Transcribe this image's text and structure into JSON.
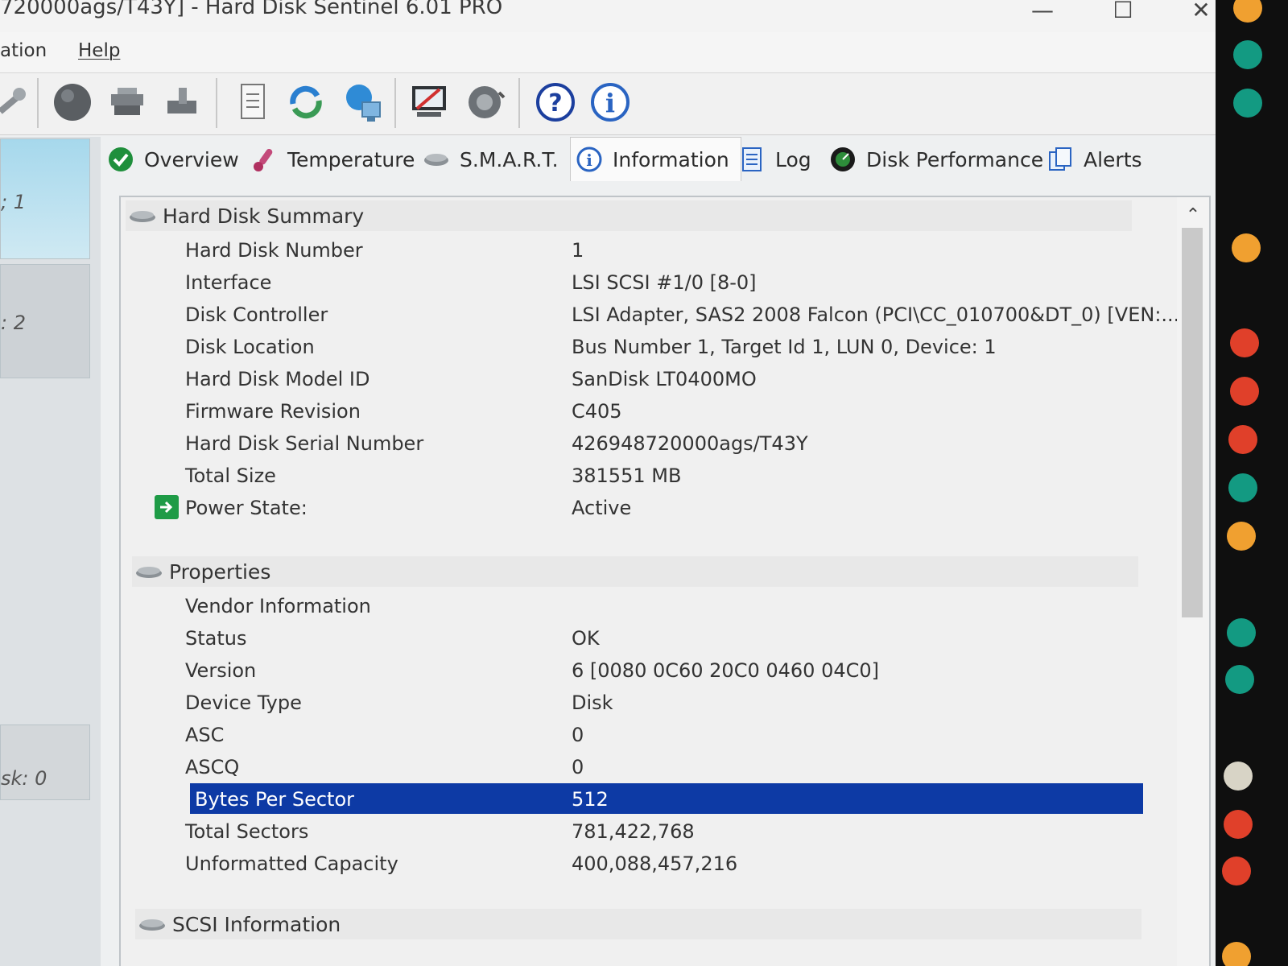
{
  "window": {
    "title": "720000ags/T43Y]  -  Hard Disk Sentinel 6.01 PRO",
    "minimize_label": "—",
    "maximize_label": "☐",
    "close_label": "✕"
  },
  "menu": {
    "items": [
      "ation",
      "Help"
    ]
  },
  "left_pane": {
    "disks": [
      "; 1",
      ": 2",
      "sk: 0"
    ]
  },
  "tabs": [
    {
      "label": "Overview",
      "icon": "check-circle-icon"
    },
    {
      "label": "Temperature",
      "icon": "thermometer-icon"
    },
    {
      "label": "S.M.A.R.T.",
      "icon": "disk-icon"
    },
    {
      "label": "Information",
      "icon": "info-icon"
    },
    {
      "label": "Log",
      "icon": "document-icon"
    },
    {
      "label": "Disk Performance",
      "icon": "performance-icon"
    },
    {
      "label": "Alerts",
      "icon": "alerts-icon"
    }
  ],
  "active_tab": "Information",
  "summary": {
    "title": "Hard Disk Summary",
    "rows": [
      {
        "key": "Hard Disk Number",
        "value": "1"
      },
      {
        "key": "Interface",
        "value": "LSI  SCSI #1/0 [8-0]"
      },
      {
        "key": "Disk Controller",
        "value": "LSI Adapter, SAS2 2008 Falcon (PCI\\CC_010700&DT_0) [VEN:..."
      },
      {
        "key": "Disk Location",
        "value": "Bus Number 1, Target Id 1, LUN 0, Device: 1"
      },
      {
        "key": "Hard Disk Model ID",
        "value": "SanDisk LT0400MO"
      },
      {
        "key": "Firmware Revision",
        "value": "C405"
      },
      {
        "key": "Hard Disk Serial Number",
        "value": "426948720000ags/T43Y"
      },
      {
        "key": "Total Size",
        "value": "381551 MB"
      },
      {
        "key": "Power State:",
        "value": "Active"
      }
    ]
  },
  "properties": {
    "title": "Properties",
    "rows": [
      {
        "key": "Vendor Information",
        "value": ""
      },
      {
        "key": "Status",
        "value": "OK"
      },
      {
        "key": "Version",
        "value": "6 [0080 0C60 20C0 0460 04C0]"
      },
      {
        "key": "Device Type",
        "value": "Disk"
      },
      {
        "key": "ASC",
        "value": "0"
      },
      {
        "key": "ASCQ",
        "value": "0"
      },
      {
        "key": "Bytes Per Sector",
        "value": "512"
      },
      {
        "key": "Total Sectors",
        "value": "781,422,768"
      },
      {
        "key": "Unformatted Capacity",
        "value": "400,088,457,216"
      }
    ]
  },
  "scsi": {
    "title": "SCSI Information"
  },
  "colors": {
    "selection": "#0d3aa5",
    "power_green": "#1e9b46"
  }
}
